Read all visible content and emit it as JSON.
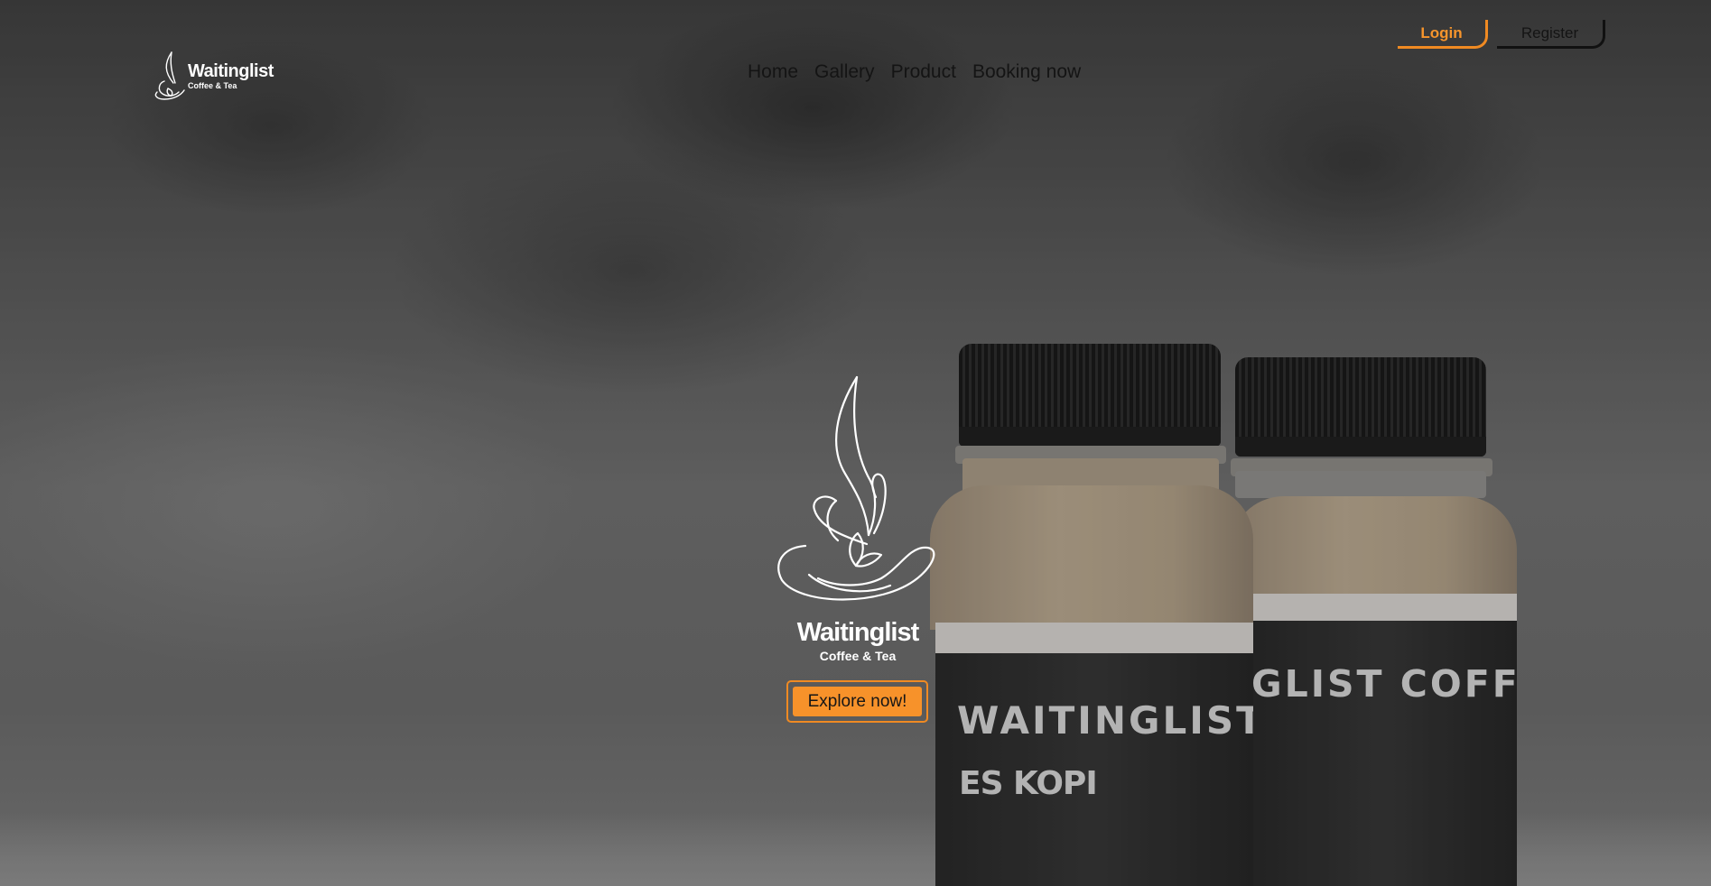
{
  "brand": {
    "name": "Waitinglist",
    "tagline": "Coffee & Tea"
  },
  "nav": {
    "items": [
      "Home",
      "Gallery",
      "Product",
      "Booking now"
    ]
  },
  "auth": {
    "login_label": "Login",
    "register_label": "Register"
  },
  "hero": {
    "logo_name": "Waitinglist",
    "logo_tagline": "Coffee & Tea",
    "cta_label": "Explore now!",
    "bottle_left_label": "WAITINGLIST COFFEE",
    "bottle_left_sub": "ES KOPI",
    "bottle_right_label": "GLIST COFFEE"
  },
  "colors": {
    "accent": "#f7922a",
    "nav_text": "#141414",
    "logo": "#ffffff"
  }
}
